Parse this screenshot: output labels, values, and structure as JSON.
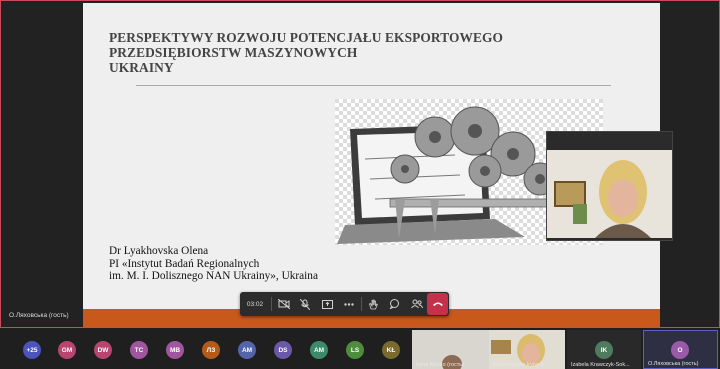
{
  "slide": {
    "title_lines": [
      "PERSPEKTYWY ROZWOJU POTENCJAŁU EKSPORTOWEGO",
      "PRZEDSIĘBIORSTW MASZYNOWYCH",
      "UKRAINY"
    ],
    "author_lines": [
      "Dr Lyakhovska Olena",
      "PI «Instytut Badań Regionalnych",
      "im. M. I. Dolisznego NAN Ukrainy», Ukraina"
    ],
    "footer_color": "#c8581b"
  },
  "presenter": {
    "name_label": "О.Ляховська (гость)"
  },
  "meeting_toolbar": {
    "timer": "03:02",
    "controls": [
      {
        "name": "camera-off-icon"
      },
      {
        "name": "mic-off-icon"
      },
      {
        "name": "share-screen-icon"
      },
      {
        "name": "more-icon"
      },
      {
        "name": "raise-hand-icon"
      },
      {
        "name": "chat-icon"
      },
      {
        "name": "participants-icon"
      },
      {
        "name": "hang-up-icon"
      }
    ],
    "hangup_color": "#c4314b"
  },
  "participants": {
    "overflow_badge": "+25",
    "avatars": [
      {
        "initials": "GM",
        "color": "#b8456e"
      },
      {
        "initials": "DW",
        "color": "#b8456e"
      },
      {
        "initials": "TC",
        "color": "#a0569e"
      },
      {
        "initials": "MB",
        "color": "#a0569e"
      },
      {
        "initials": "ЛЗ",
        "color": "#b35c1a"
      },
      {
        "initials": "AM",
        "color": "#5464a8"
      },
      {
        "initials": "DS",
        "color": "#6c58a8"
      },
      {
        "initials": "AM",
        "color": "#3c8a6c"
      },
      {
        "initials": "LS",
        "color": "#4e8c3e"
      },
      {
        "initials": "KŁ",
        "color": "#7a6a30"
      }
    ],
    "video_tiles": [
      {
        "label": "Iryna Mysko (гость)"
      },
      {
        "label": "Storonianska Iryna (г..."
      }
    ],
    "named_avatars": [
      {
        "initials": "IK",
        "label": "Izabela Krawczyk-Sok..."
      },
      {
        "initials": "O",
        "label": "О.Ляховська (гость)"
      }
    ]
  }
}
